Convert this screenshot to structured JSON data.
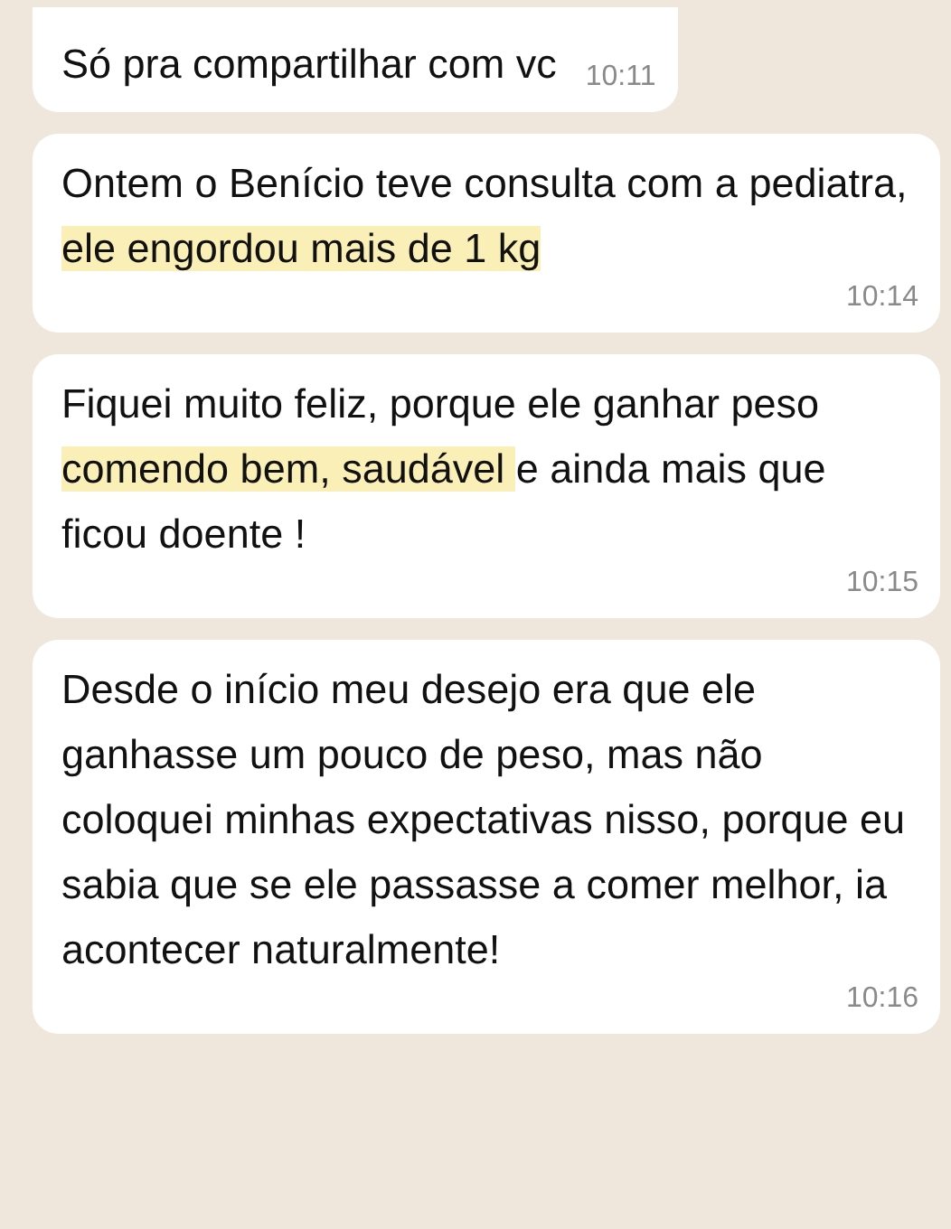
{
  "messages": [
    {
      "parts": [
        {
          "text": "Só pra compartilhar com vc",
          "highlighted": false
        }
      ],
      "time": "10:11"
    },
    {
      "parts": [
        {
          "text": "Ontem o Benício teve consulta com a pediatra, ",
          "highlighted": false
        },
        {
          "text": "ele engordou mais de 1 kg",
          "highlighted": true
        }
      ],
      "time": "10:14"
    },
    {
      "parts": [
        {
          "text": "Fiquei muito feliz, porque ele ganhar peso ",
          "highlighted": false
        },
        {
          "text": "comendo bem, saudável ",
          "highlighted": true
        },
        {
          "text": "e ainda mais que ficou doente !",
          "highlighted": false
        }
      ],
      "time": "10:15"
    },
    {
      "parts": [
        {
          "text": "Desde o início meu desejo era que ele ganhasse um pouco de peso, mas não coloquei minhas expectativas nisso, porque eu sabia que se ele passasse a comer melhor, ia acontecer naturalmente!",
          "highlighted": false
        }
      ],
      "time": "10:16"
    }
  ]
}
